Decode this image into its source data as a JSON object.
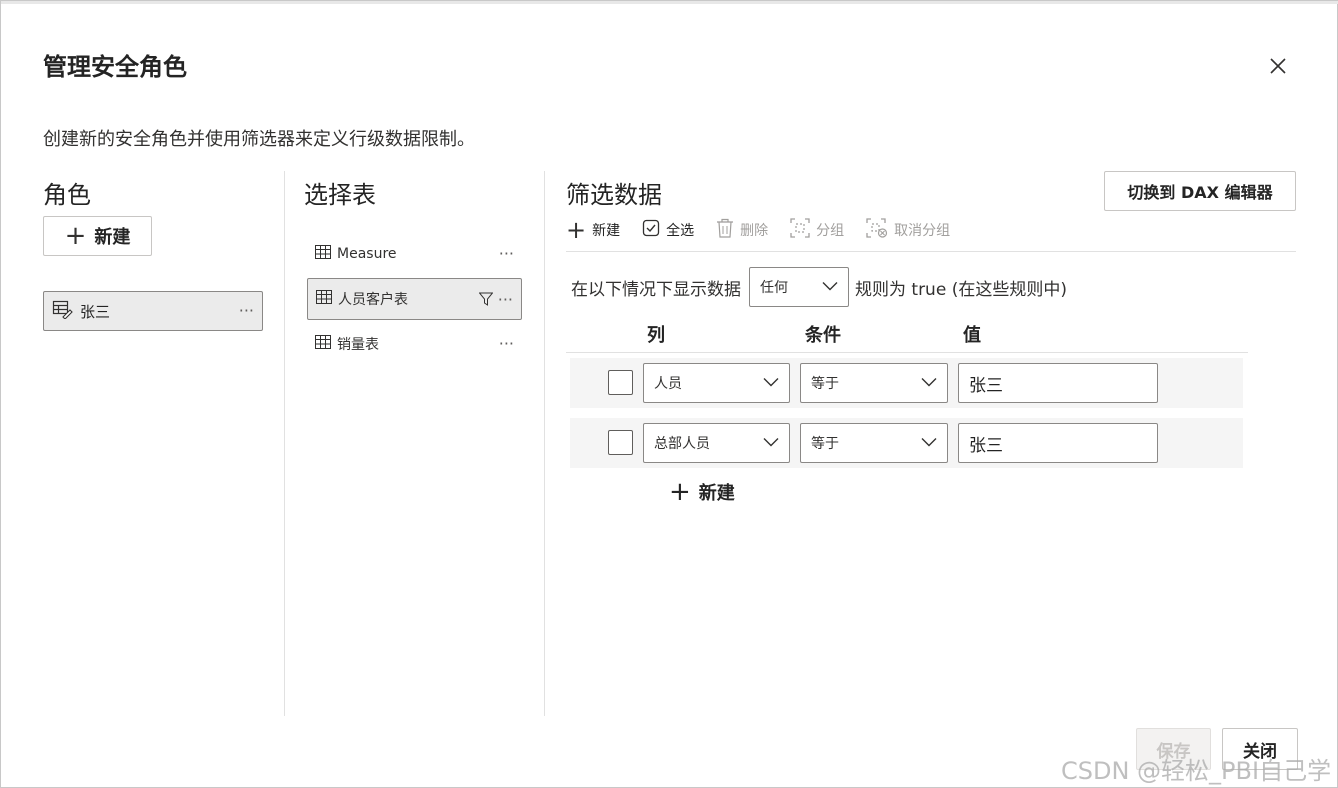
{
  "dialog": {
    "title": "管理安全角色",
    "subtitle": "创建新的安全角色并使用筛选器来定义行级数据限制。"
  },
  "roles": {
    "heading": "角色",
    "new_button": "新建",
    "items": [
      {
        "label": "张三"
      }
    ]
  },
  "tables": {
    "heading": "选择表",
    "items": [
      {
        "label": "Measure",
        "selected": false
      },
      {
        "label": "人员客户表",
        "selected": true
      },
      {
        "label": "销量表",
        "selected": false
      }
    ]
  },
  "filter": {
    "heading": "筛选数据",
    "dax_button": "切换到 DAX 编辑器",
    "toolbar": {
      "new": "新建",
      "select_all": "全选",
      "delete": "删除",
      "group": "分组",
      "ungroup": "取消分组"
    },
    "rule_prefix": "在以下情况下显示数据",
    "rule_any": "任何",
    "rule_suffix": "规则为 true (在这些规则中)",
    "headers": {
      "column": "列",
      "condition": "条件",
      "value": "值"
    },
    "rows": [
      {
        "column": "人员",
        "condition": "等于",
        "value": "张三"
      },
      {
        "column": "总部人员",
        "condition": "等于",
        "value": "张三"
      }
    ],
    "new_rule": "新建"
  },
  "footer": {
    "save": "保存",
    "close": "关闭"
  },
  "watermark": "CSDN @轻松_PBI自己学"
}
